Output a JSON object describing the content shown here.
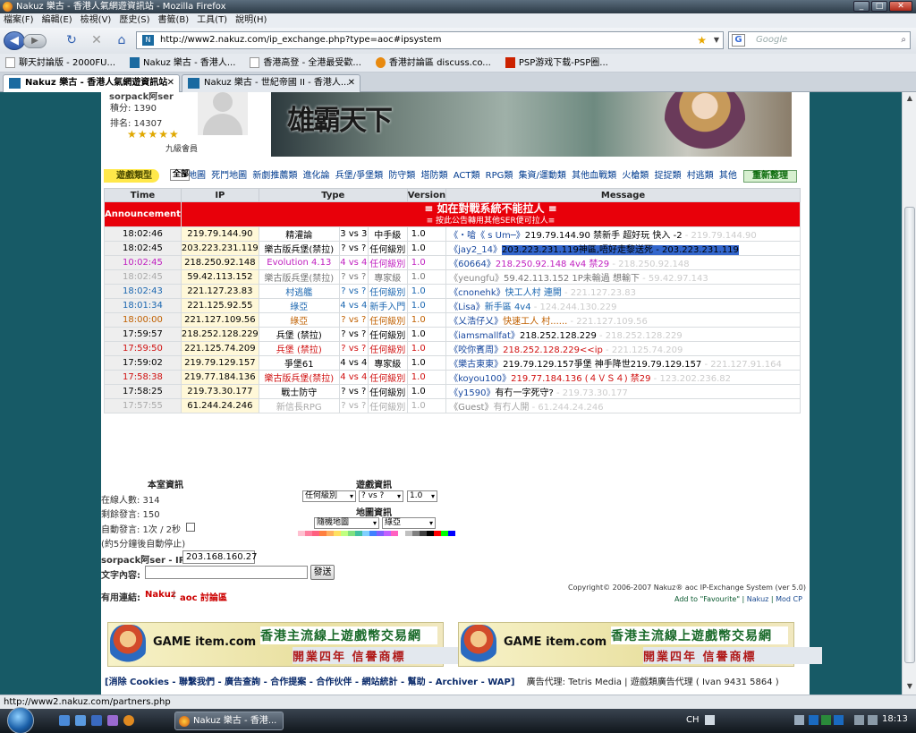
{
  "window": {
    "title": "Nakuz 樂古 - 香港人氣網遊資訊站 - Mozilla Firefox",
    "min": "_",
    "max": "□",
    "close": "✕"
  },
  "menu": [
    "檔案(F)",
    "編輯(E)",
    "檢視(V)",
    "歷史(S)",
    "書籤(B)",
    "工具(T)",
    "說明(H)"
  ],
  "nav": {
    "url": "http://www2.nakuz.com/ip_exchange.php?type=aoc#ipsystem",
    "search_placeholder": "Google",
    "google_label": "G",
    "back": "◀",
    "forward": "▶",
    "reload": "↻",
    "stop": "✕",
    "home": "⌂"
  },
  "bookmarks": [
    "聊天討論版 - 2000FU...",
    "Nakuz 樂古 - 香港人...",
    "香港高登 - 全港最受歡...",
    "香港討論區 discuss.co...",
    "PSP游戏下载-PSP圈..."
  ],
  "tabs": [
    {
      "label": "Nakuz 樂古 - 香港人氣網遊資訊站"
    },
    {
      "label": "Nakuz 樂古 - 世紀帝國 II - 香港人..."
    }
  ],
  "user": {
    "name": "sorpack阿ser",
    "points": "積分: 1390",
    "rank": "排名: 14307",
    "stars": "★★★★★",
    "level": "九級會員"
  },
  "banner": {
    "logo": "雄霸天下"
  },
  "categories": {
    "label": "遊戲類型",
    "items": [
      "全部",
      "隨機地圖",
      "死鬥地圖",
      "新劇推薦類",
      "進化論",
      "兵堡/爭堡類",
      "防守類",
      "塔防類",
      "ACT類",
      "RPG類",
      "集資/運動類",
      "其他血戰類",
      "火槍類",
      "捉捉類",
      "村逃類",
      "其他"
    ],
    "refresh": "重新整理"
  },
  "table": {
    "headers": [
      "Time",
      "IP",
      "Type",
      "Version",
      "Message"
    ],
    "announcement": {
      "label": "Announcement",
      "line1": "≡ 如在對戰系統不能拉人 ≡",
      "line2": "≡ 按此公告轉用其他SER便可拉人≡"
    },
    "rows": [
      {
        "time": "18:02:46",
        "ip": "219.79.144.90",
        "room": "精灌論",
        "vs": "3 vs 3",
        "lvl": "中手級",
        "ver": "1.0",
        "user": "《・嗆《 s Um─》",
        "msg": "219.79.144.90 禁新手 超好玩 快入 -2",
        "ip2": " - 219.79.144.90",
        "color": "#000000",
        "gray": false
      },
      {
        "time": "18:02:45",
        "ip": "203.223.231.119",
        "room": "樂古版兵堡(禁拉)",
        "vs": "? vs ?",
        "lvl": "任何級別",
        "ver": "1.0",
        "user": "《jay2_14》",
        "msg": "203.223.231.119神區,唔好走黎送死 - 203.223.231.119",
        "ip2": "",
        "color": "#000000",
        "gray": false,
        "highlight": true
      },
      {
        "time": "10:02:45",
        "ip": "218.250.92.148",
        "room": "Evolution 4.13",
        "vs": "4 vs 4",
        "lvl": "任何級別",
        "ver": "1.0",
        "user": "《60664》",
        "msg": "218.250.92.148 4v4 禁29",
        "ip2": " - 218.250.92.148",
        "color": "#c020c0",
        "gray": false
      },
      {
        "time": "18:02:45",
        "ip": "59.42.113.152",
        "room": "樂古版兵堡(禁拉)",
        "vs": "? vs ?",
        "lvl": "專家級",
        "ver": "1.0",
        "user": "《yeungfu》",
        "msg": "59.42.113.152 1P未輸過 想輸下",
        "ip2": " - 59.42.97.143",
        "color": "#777777",
        "gray": true
      },
      {
        "time": "18:02:43",
        "ip": "221.127.23.83",
        "room": "村逃艦",
        "vs": "? vs ?",
        "lvl": "任何級別",
        "ver": "1.0",
        "user": "《cnonehk》",
        "msg": "快工人村 連開",
        "ip2": " - 221.127.23.83",
        "color": "#1a66b0",
        "gray": false
      },
      {
        "time": "18:01:34",
        "ip": "221.125.92.55",
        "room": "綠亞",
        "vs": "4 vs 4",
        "lvl": "新手入門",
        "ver": "1.0",
        "user": "《Lisa》",
        "msg": "新手區 4v4",
        "ip2": " - 124.244.130.229",
        "color": "#1a66b0",
        "gray": false
      },
      {
        "time": "18:00:00",
        "ip": "221.127.109.56",
        "room": "綠亞",
        "vs": "? vs ?",
        "lvl": "任何級別",
        "ver": "1.0",
        "user": "《乂浩仔乂》",
        "msg": "快速工人 村......",
        "ip2": " - 221.127.109.56",
        "color": "#c06000",
        "gray": false
      },
      {
        "time": "17:59:57",
        "ip": "218.252.128.229",
        "room": "兵堡 (禁拉)",
        "vs": "? vs ?",
        "lvl": "任何級別",
        "ver": "1.0",
        "user": "《iamsmallfat》",
        "msg": "218.252.128.229",
        "ip2": " - 218.252.128.229",
        "color": "#000000",
        "gray": false
      },
      {
        "time": "17:59:50",
        "ip": "221.125.74.209",
        "room": "兵堡 (禁拉)",
        "vs": "? vs ?",
        "lvl": "任何級別",
        "ver": "1.0",
        "user": "《咬你賓周》",
        "msg": "218.252.128.229<<ip",
        "ip2": " - 221.125.74.209",
        "color": "#d01010",
        "gray": false
      },
      {
        "time": "17:59:02",
        "ip": "219.79.129.157",
        "room": "爭堡61",
        "vs": "4 vs 4",
        "lvl": "專家級",
        "ver": "1.0",
        "user": "《樂古東東》",
        "msg": "219.79.129.157爭堡 神手降世219.79.129.157",
        "ip2": " - 221.127.91.164",
        "color": "#000000",
        "gray": false
      },
      {
        "time": "17:58:38",
        "ip": "219.77.184.136",
        "room": "樂古版兵堡(禁拉)",
        "vs": "4 vs 4",
        "lvl": "任何級別",
        "ver": "1.0",
        "user": "《koyou100》",
        "msg": "219.77.184.136 (４ＶＳ４) 禁29",
        "ip2": " - 123.202.236.82",
        "color": "#d01010",
        "gray": false
      },
      {
        "time": "17:58:25",
        "ip": "219.73.30.177",
        "room": "戰士防守",
        "vs": "? vs ?",
        "lvl": "任何級別",
        "ver": "1.0",
        "user": "《y1590》",
        "msg": "有冇一字死守?",
        "ip2": " - 219.73.30.177",
        "color": "#000000",
        "gray": false
      },
      {
        "time": "17:57:55",
        "ip": "61.244.24.246",
        "room": "新信長RPG",
        "vs": "? vs ?",
        "lvl": "任何級別",
        "ver": "1.0",
        "user": "《Guest》",
        "msg": "有冇人開",
        "ip2": " - 61.244.24.246",
        "color": "#aaaaaa",
        "gray": true
      }
    ]
  },
  "room_info": {
    "title": "本室資訊",
    "online": "在線人數: 314",
    "remaining": "剩餘發言: 150",
    "auto": "自動發言: 1次 / 2秒",
    "auto_note": "(約5分鐘後自動停止)",
    "ip_label": "sorpack阿ser - IP:",
    "ip_value": "203.168.160.27",
    "text_label": "文字內容:",
    "send": "發送",
    "links_label": "有用連結:",
    "link1": "Nakuz",
    "link2": "aoc 討論區"
  },
  "game_info": {
    "title": "遊戲資訊",
    "level": "任何級別",
    "vs": "? vs ?",
    "ver": "1.0",
    "map_title": "地圖資訊",
    "map": "隨機地圖",
    "map2": "綠亞",
    "palette": [
      "#ffc0d0",
      "#ff80a0",
      "#ff6080",
      "#ff8040",
      "#ffb060",
      "#ffe060",
      "#c0ff80",
      "#80e080",
      "#40c0a0",
      "#80d0ff",
      "#4080ff",
      "#8060ff",
      "#c060ff",
      "#ff60c0",
      "#ffffff",
      "#c0c0c0",
      "#808080",
      "#404040",
      "#000000",
      "#ff0000",
      "#00ff00",
      "#0000ff"
    ]
  },
  "copyright": {
    "line": "Copyright© 2006-2007  Nakuz® aoc IP-Exchange System (ver 5.0)",
    "fav": "Add to \"Favourite\"",
    "nakuz": "Nakuz",
    "modcp": "Mod CP"
  },
  "ads": [
    {
      "logo": "GAME item.com",
      "t1": "香港主流線上遊戲幣交易網",
      "t2": "開業四年 信譽商標"
    },
    {
      "logo": "GAME item.com",
      "t1": "香港主流線上遊戲幣交易網",
      "t2": "開業四年 信譽商標"
    }
  ],
  "footer": {
    "links": "[消除 Cookies - 聯繫我們 - 廣告查詢 - 合作提案 - 合作伙伴 - 網站統計 - 幫助 - Archiver - WAP]",
    "agent": "廣告代理: Tetris Media | 遊戲類廣告代理 ( Ivan 9431 5864 )"
  },
  "status": {
    "url": "http://www2.nakuz.com/partners.php"
  },
  "taskbar": {
    "active": "Nakuz 樂古 - 香港...",
    "lang": "CH",
    "time": "18:13"
  }
}
